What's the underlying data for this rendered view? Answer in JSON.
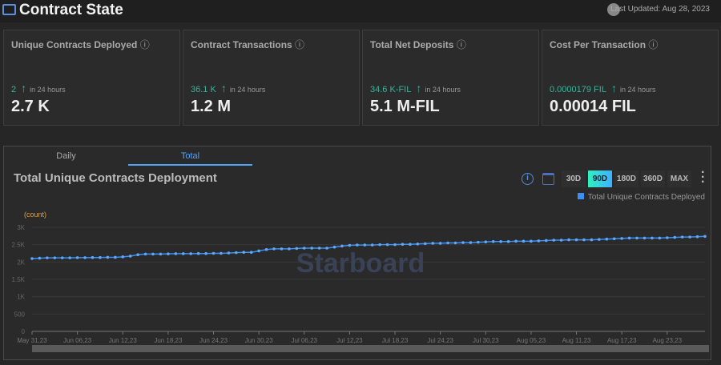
{
  "header": {
    "title": "Contract State",
    "last_updated": "Last Updated: Aug 28, 2023"
  },
  "cards": [
    {
      "label": "Unique Contracts Deployed",
      "delta": "2",
      "delta_note": "in 24 hours",
      "value": "2.7 K"
    },
    {
      "label": "Contract Transactions",
      "delta": "36.1 K",
      "delta_note": "in 24 hours",
      "value": "1.2 M"
    },
    {
      "label": "Total Net Deposits",
      "delta": "34.6 K-FIL",
      "delta_note": "in 24 hours",
      "value": "5.1 M-FIL"
    },
    {
      "label": "Cost Per Transaction",
      "delta": "0.0000179 FIL",
      "delta_note": "in 24 hours",
      "value": "0.00014 FIL"
    }
  ],
  "tabs": [
    {
      "label": "Daily"
    },
    {
      "label": "Total"
    }
  ],
  "active_tab": "Total",
  "chart_panel": {
    "title": "Total Unique Contracts Deployment",
    "ranges": [
      "30D",
      "90D",
      "180D",
      "360D",
      "MAX"
    ],
    "active_range": "90D",
    "watermark": "Starboard"
  },
  "colors": {
    "accent": "#4ea3ff",
    "series": "#3f8ff0",
    "positive": "#3bb39a",
    "unit": "#e0a040"
  },
  "chart_data": {
    "type": "line",
    "title": "Total Unique Contracts Deployment",
    "ylabel": "(count)",
    "ylim": [
      0,
      3000
    ],
    "y_ticks": [
      "0",
      "500",
      "1K",
      "1.5K",
      "2K",
      "2.5K",
      "3K"
    ],
    "x_ticks": [
      "May 31,23",
      "Jun 06,23",
      "Jun 12,23",
      "Jun 18,23",
      "Jun 24,23",
      "Jun 30,23",
      "Jul 06,23",
      "Jul 12,23",
      "Jul 18,23",
      "Jul 24,23",
      "Jul 30,23",
      "Aug 05,23",
      "Aug 11,23",
      "Aug 17,23",
      "Aug 23,23"
    ],
    "x_range": [
      "May 31,23",
      "Aug 28,23"
    ],
    "grid": true,
    "legend": "top-right",
    "series": [
      {
        "name": "Total Unique Contracts Deployed",
        "values": [
          2100,
          2110,
          2120,
          2120,
          2120,
          2120,
          2125,
          2125,
          2130,
          2130,
          2135,
          2135,
          2150,
          2170,
          2210,
          2230,
          2230,
          2230,
          2235,
          2240,
          2240,
          2240,
          2245,
          2245,
          2250,
          2250,
          2260,
          2270,
          2280,
          2280,
          2320,
          2360,
          2380,
          2380,
          2380,
          2390,
          2400,
          2400,
          2400,
          2400,
          2430,
          2460,
          2480,
          2490,
          2490,
          2490,
          2500,
          2500,
          2500,
          2510,
          2510,
          2520,
          2530,
          2540,
          2540,
          2550,
          2550,
          2560,
          2560,
          2570,
          2580,
          2590,
          2590,
          2590,
          2600,
          2600,
          2600,
          2610,
          2620,
          2630,
          2630,
          2640,
          2640,
          2640,
          2640,
          2650,
          2660,
          2670,
          2680,
          2690,
          2690,
          2690,
          2690,
          2690,
          2700,
          2710,
          2720,
          2720,
          2730,
          2740
        ]
      }
    ]
  }
}
